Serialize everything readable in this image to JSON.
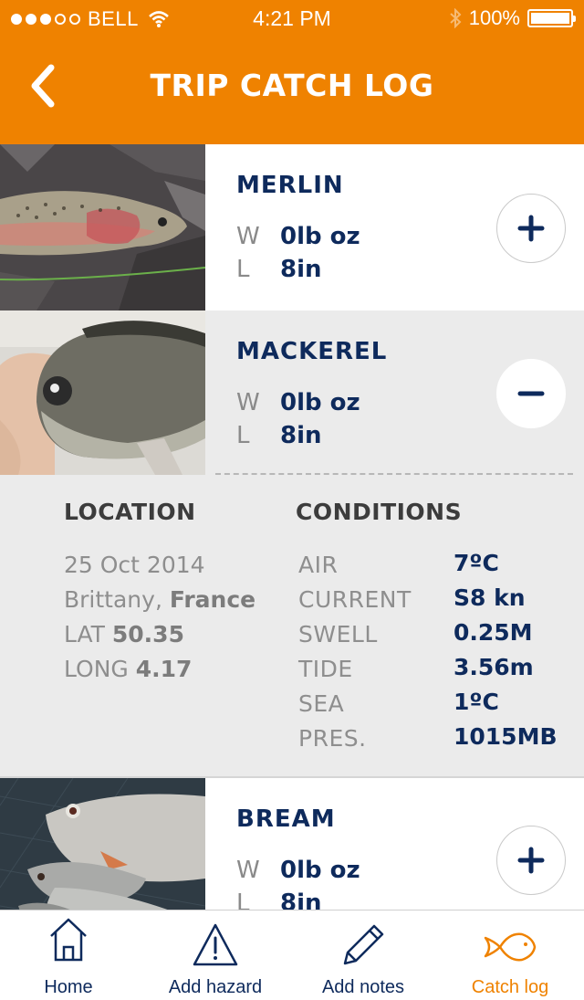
{
  "status_bar": {
    "carrier": "BELL",
    "time": "4:21 PM",
    "battery": "100%"
  },
  "header": {
    "title": "TRIP CATCH LOG"
  },
  "catches": [
    {
      "name": "MERLIN",
      "w_label": "W",
      "weight": "0lb oz",
      "l_label": "L",
      "length": "8in",
      "action": "expand"
    },
    {
      "name": "MACKEREL",
      "w_label": "W",
      "weight": "0lb oz",
      "l_label": "L",
      "length": "8in",
      "action": "collapse"
    },
    {
      "name": "BREAM",
      "w_label": "W",
      "weight": "0lb oz",
      "l_label": "L",
      "length": "8in",
      "action": "expand"
    }
  ],
  "details": {
    "location_heading": "LOCATION",
    "date": "25 Oct 2014",
    "region": "Brittany,",
    "country": "France",
    "lat_label": "LAT",
    "lat": "50.35",
    "long_label": "LONG",
    "long": "4.17",
    "conditions_heading": "CONDITIONS",
    "conditions": [
      {
        "label": "AIR",
        "value": "7ºC"
      },
      {
        "label": "CURRENT",
        "value": "S8 kn"
      },
      {
        "label": "SWELL",
        "value": "0.25M"
      },
      {
        "label": "TIDE",
        "value": "3.56m"
      },
      {
        "label": "SEA",
        "value": "1ºC"
      },
      {
        "label": "PRES.",
        "value": "1015MB"
      }
    ]
  },
  "tabs": [
    {
      "label": "Home",
      "icon": "home-icon"
    },
    {
      "label": "Add hazard",
      "icon": "hazard-icon"
    },
    {
      "label": "Add notes",
      "icon": "pencil-icon"
    },
    {
      "label": "Catch log",
      "icon": "fish-icon",
      "active": true
    }
  ],
  "colors": {
    "accent": "#ef8200",
    "navy": "#0e2a5c",
    "panel": "#ebebeb"
  }
}
